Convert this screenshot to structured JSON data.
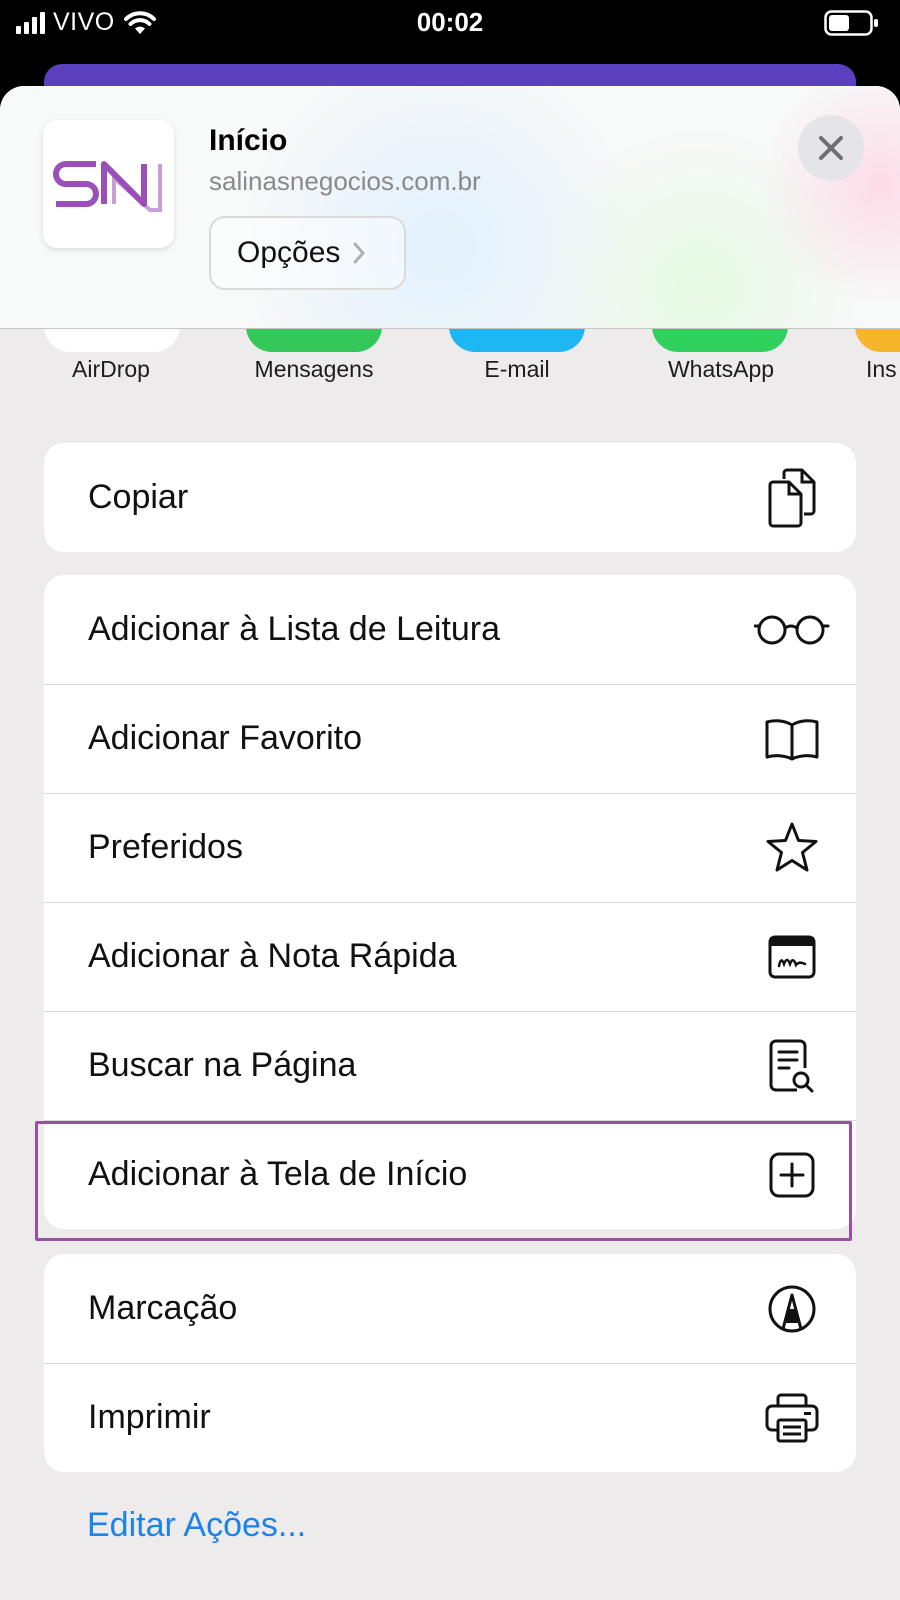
{
  "status_bar": {
    "carrier": "VIVO",
    "time": "00:02"
  },
  "header": {
    "title": "Início",
    "url": "salinasnegocios.com.br",
    "options_label": "Opções",
    "logo_text": "SN",
    "logo_color": "#9b4fb8"
  },
  "apps": [
    {
      "label": "AirDrop",
      "color": "#ffffff"
    },
    {
      "label": "Mensagens",
      "color": "#34c759"
    },
    {
      "label": "E-mail",
      "color": "#1fb7f2"
    },
    {
      "label": "WhatsApp",
      "color": "#2fd05c"
    },
    {
      "label": "Ins",
      "color": "#f7b52c"
    }
  ],
  "groups": {
    "copy": [
      {
        "label": "Copiar",
        "icon": "copy-icon"
      }
    ],
    "actions": [
      {
        "label": "Adicionar à Lista de Leitura",
        "icon": "glasses-icon"
      },
      {
        "label": "Adicionar Favorito",
        "icon": "book-icon"
      },
      {
        "label": "Preferidos",
        "icon": "star-icon"
      },
      {
        "label": "Adicionar à Nota Rápida",
        "icon": "quick-note-icon"
      },
      {
        "label": "Buscar na Página",
        "icon": "find-in-page-icon"
      },
      {
        "label": "Adicionar à Tela de Início",
        "icon": "add-square-icon"
      }
    ],
    "more": [
      {
        "label": "Marcação",
        "icon": "markup-icon"
      },
      {
        "label": "Imprimir",
        "icon": "printer-icon"
      }
    ]
  },
  "edit_actions_label": "Editar Ações...",
  "colors": {
    "highlight": "#9a4fa3",
    "link": "#1b84e8",
    "accent_strip": "#5a3fbe"
  }
}
